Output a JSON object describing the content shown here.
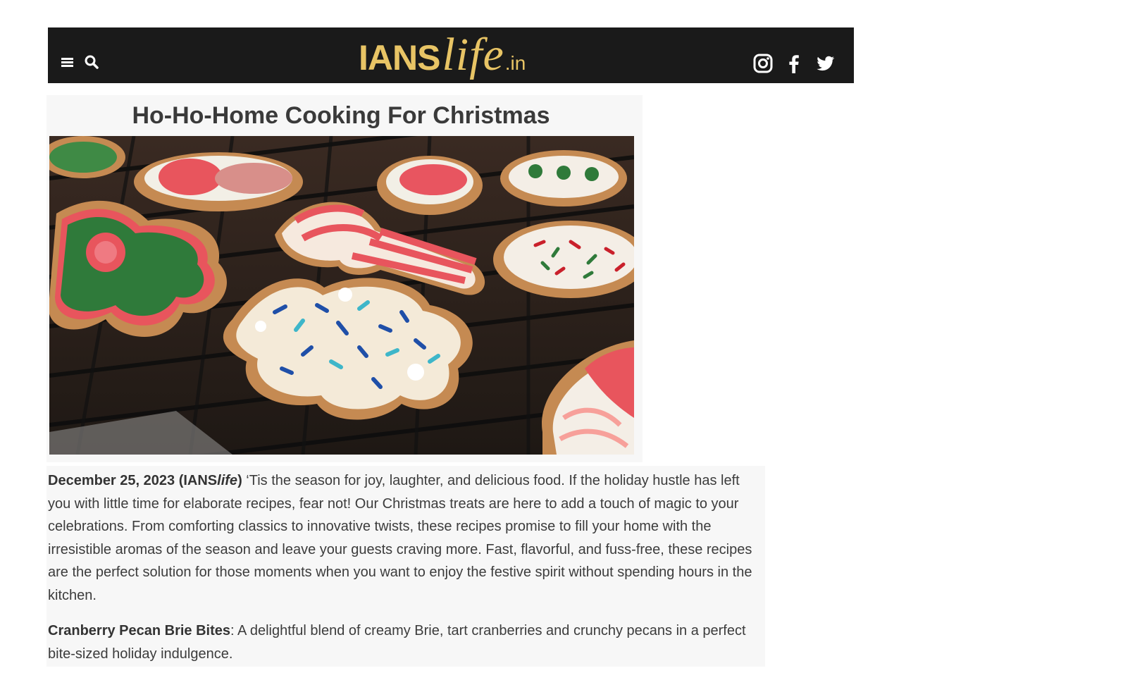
{
  "header": {
    "menu_icon": "hamburger-menu-icon",
    "search_icon": "search-icon",
    "logo": {
      "brand": "IANS",
      "suffix": "life",
      "tld": ".in"
    },
    "social": [
      "instagram-icon",
      "facebook-icon",
      "twitter-icon"
    ],
    "background_color": "#1a1a1a",
    "logo_color": "#e8c465"
  },
  "article": {
    "title": "Ho-Ho-Home Cooking For Christmas",
    "dateline": {
      "date": "December 25, 2023",
      "source_prefix": "(IANS",
      "source_italic": "life",
      "source_suffix": ")"
    },
    "intro": " ‘Tis the season for joy, laughter, and delicious food. If the holiday hustle has left you with little time for elaborate recipes, fear not! Our Christmas treats are here to add a touch of magic to your celebrations. From comforting classics to innovative twists, these recipes promise to fill your home with the irresistible aromas of the season and leave your guests craving more. Fast, flavorful, and fuss-free, these recipes are the perfect solution for those moments when you want to enjoy the festive spirit without spending hours in the kitchen.",
    "recipe_1": {
      "name": "Cranberry Pecan Brie Bites",
      "description": ": A delightful blend of creamy Brie, tart cranberries and crunchy pecans in a perfect bite-sized holiday indulgence."
    }
  }
}
